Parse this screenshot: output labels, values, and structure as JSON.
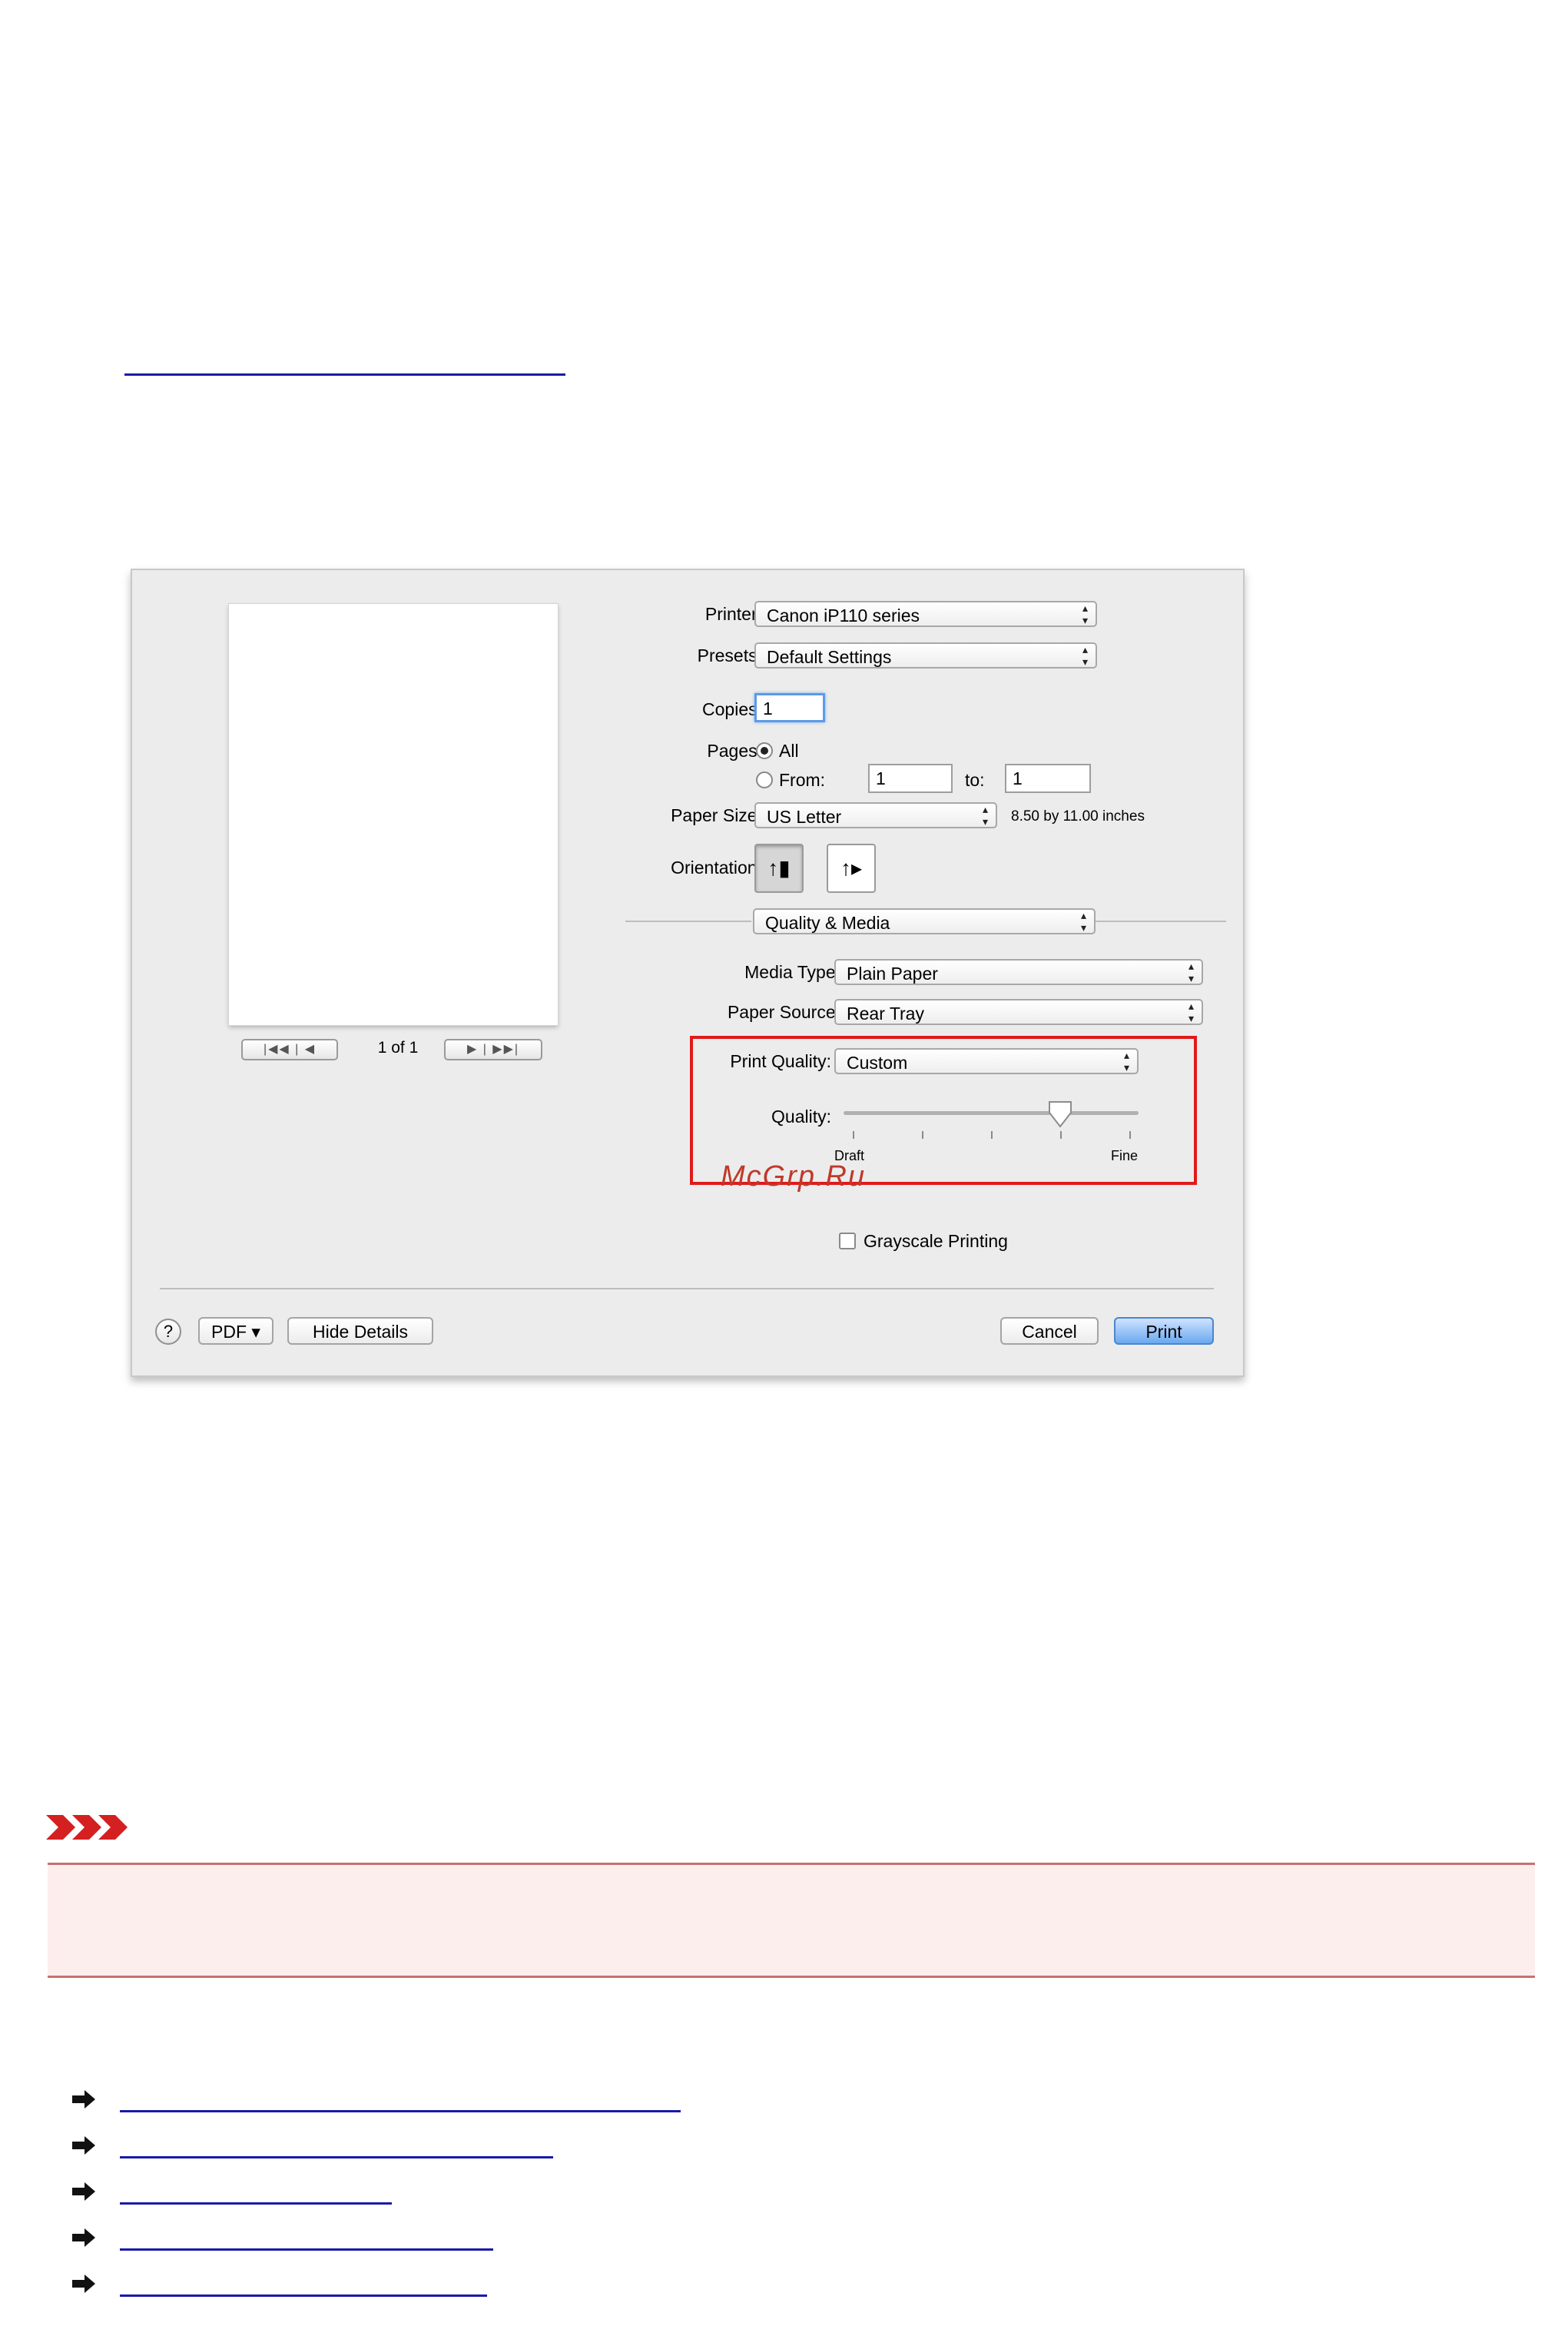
{
  "dialog": {
    "printer": {
      "label": "Printer:",
      "value": "Canon iP110 series"
    },
    "presets": {
      "label": "Presets:",
      "value": "Default Settings"
    },
    "copies": {
      "label": "Copies:",
      "value": "1"
    },
    "pages": {
      "label": "Pages:",
      "all": "All",
      "from_label": "From:",
      "from_value": "1",
      "to_label": "to:",
      "to_value": "1"
    },
    "paper_size": {
      "label": "Paper Size:",
      "value": "US Letter",
      "dimensions": "8.50 by 11.00 inches"
    },
    "orientation": {
      "label": "Orientation:",
      "portrait_icon": "portrait-icon",
      "landscape_icon": "landscape-icon"
    },
    "panel": {
      "value": "Quality & Media"
    },
    "media_type": {
      "label": "Media Type:",
      "value": "Plain Paper"
    },
    "paper_source": {
      "label": "Paper Source:",
      "value": "Rear Tray"
    },
    "print_quality": {
      "label": "Print Quality:",
      "value": "Custom"
    },
    "quality": {
      "label": "Quality:",
      "min_label": "Draft",
      "max_label": "Fine",
      "level": 0.75
    },
    "grayscale": {
      "label": "Grayscale Printing",
      "checked": false
    },
    "preview_nav": {
      "first_prev": "|◀◀ | ◀",
      "page": "1 of 1",
      "next_last": "▶ | ▶▶|"
    },
    "footer": {
      "help": "?",
      "pdf": "PDF ▾",
      "hide_details": "Hide Details",
      "cancel": "Cancel",
      "print": "Print"
    }
  },
  "watermark": "McGrp.Ru",
  "colors": {
    "highlight": "#e01a1a",
    "link": "#1a1aa8",
    "important_bg": "#fdeeee",
    "important_border": "#c97070"
  }
}
